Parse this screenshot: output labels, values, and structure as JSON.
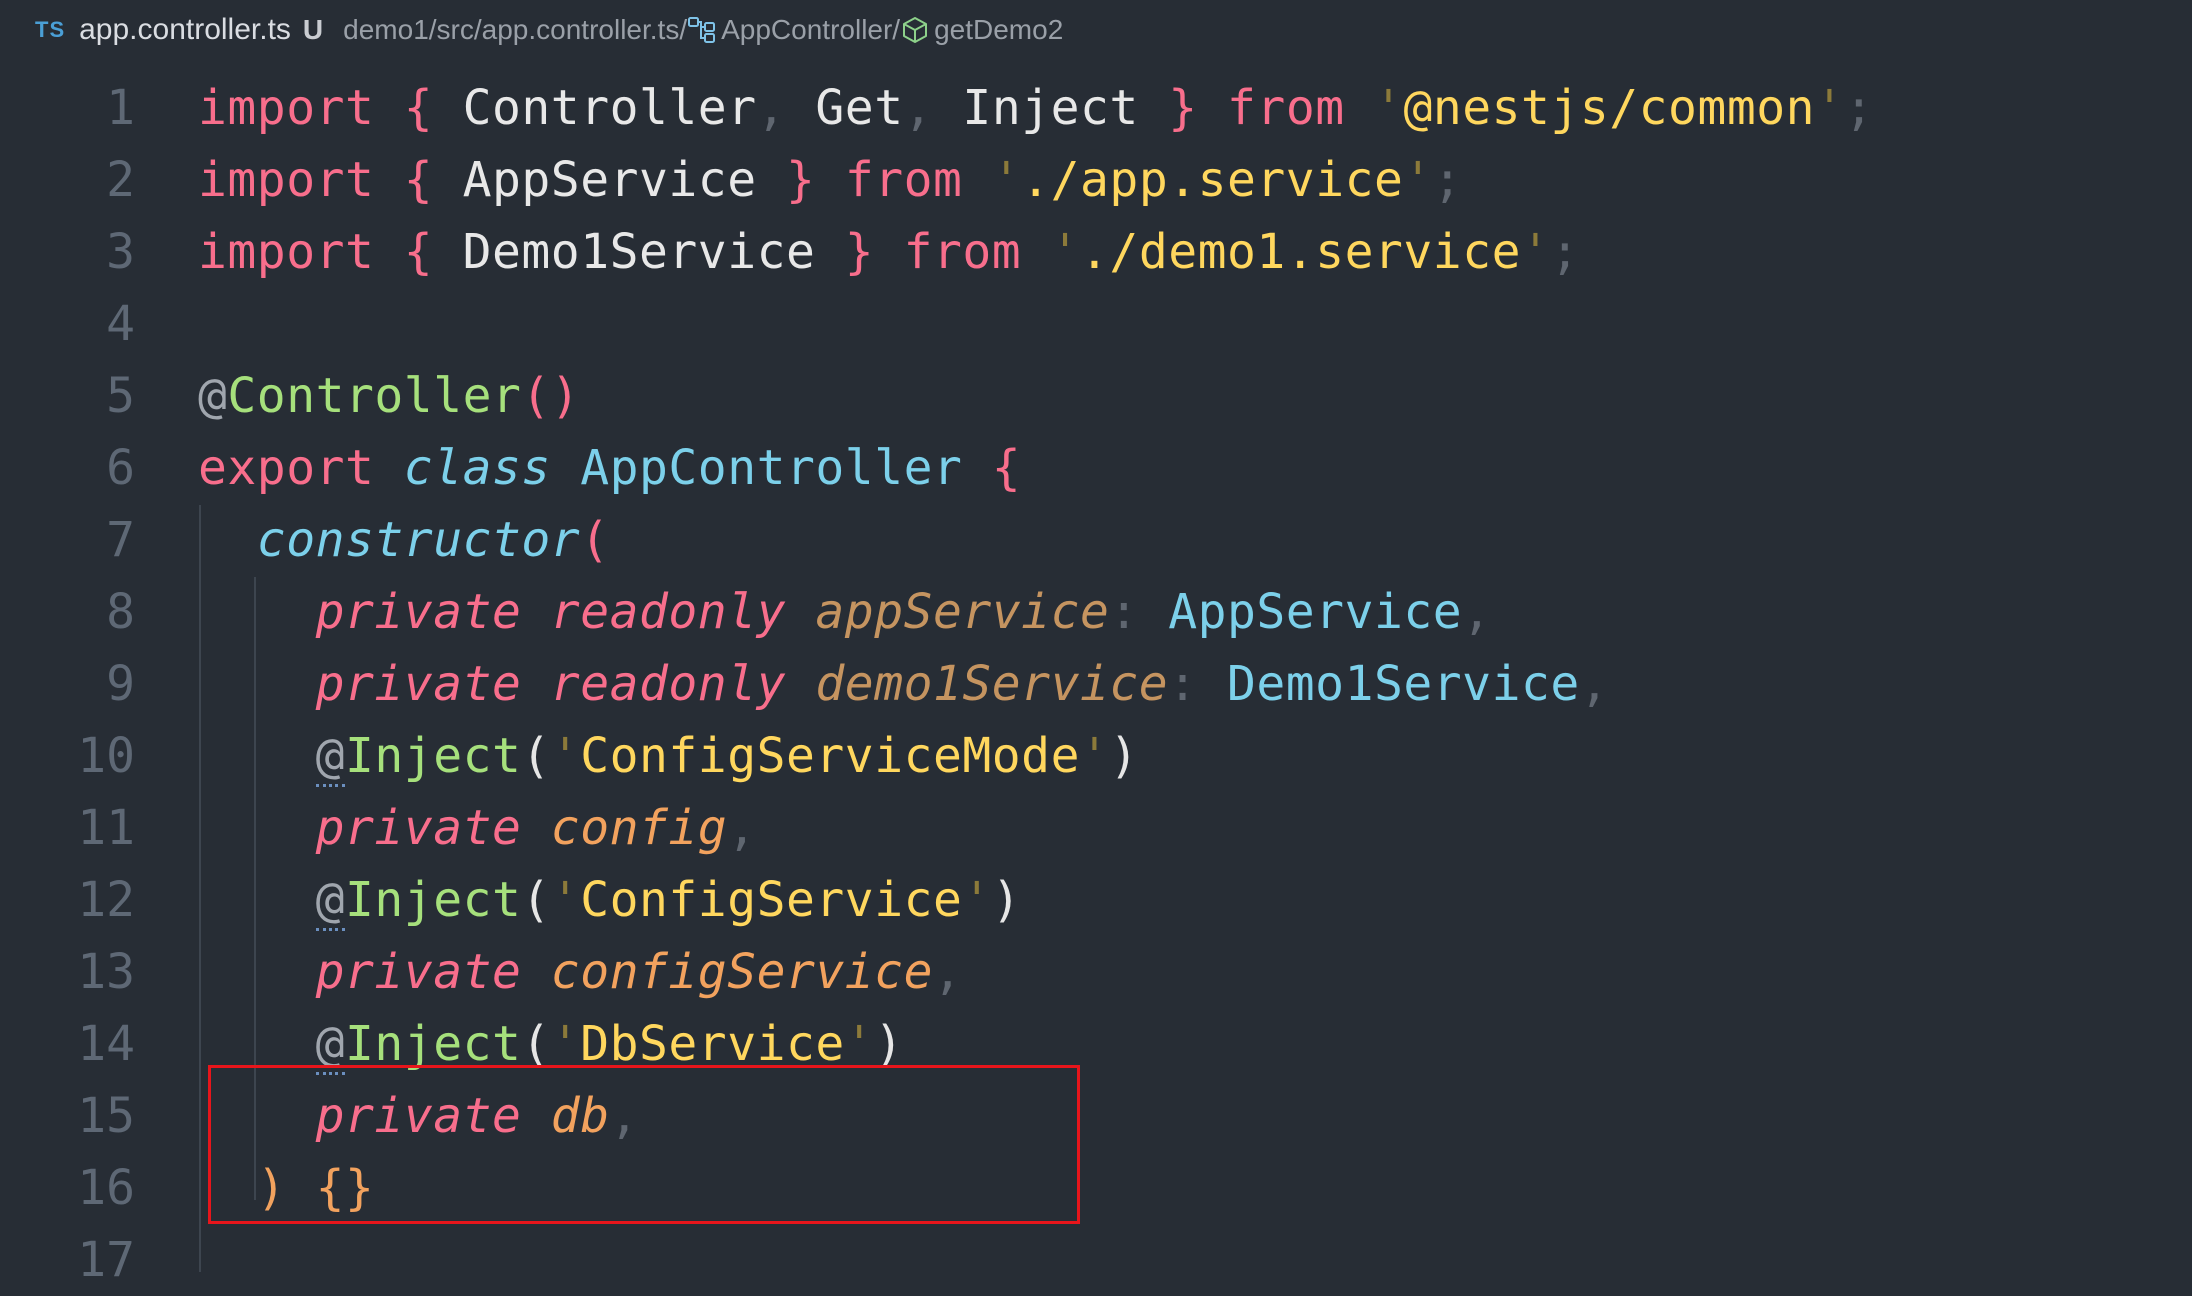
{
  "tab": {
    "lang_badge": "TS",
    "filename": "app.controller.ts",
    "status": "U"
  },
  "breadcrumb": {
    "path": "demo1/src/app.controller.ts/",
    "class_name": "AppController/",
    "method_name": "getDemo2"
  },
  "editor": {
    "line_numbers": [
      "1",
      "2",
      "3",
      "4",
      "5",
      "6",
      "7",
      "8",
      "9",
      "10",
      "11",
      "12",
      "13",
      "14",
      "15",
      "16",
      "17"
    ],
    "tokens": {
      "import": "import",
      "from": "from",
      "lbrace": "{",
      "rbrace": "}",
      "comma": ",",
      "semi": ";",
      "quote": "'",
      "controller": "Controller",
      "get": "Get",
      "inject": "Inject",
      "nestjs_common": "@nestjs/common",
      "app_service": "AppService",
      "app_service_path": "./app.service",
      "demo1_service": "Demo1Service",
      "demo1_service_path": "./demo1.service",
      "at": "@",
      "controller_call": "Controller",
      "parens": "()",
      "export": "export",
      "class": "class",
      "app_controller": "AppController",
      "constructor": "constructor",
      "lparen": "(",
      "rparen": ")",
      "private": "private",
      "readonly": "readonly",
      "app_service_param": "appService",
      "demo1_service_param": "demo1Service",
      "colon": ":",
      "config_service_mode": "ConfigServiceMode",
      "config": "config",
      "config_service_str": "ConfigService",
      "config_service_param": "configService",
      "db_service_str": "DbService",
      "db": "db",
      "empty_body": "{}"
    }
  },
  "colors": {
    "background": "#272d35",
    "keyword": "#f86e8c",
    "string": "#ffd75e",
    "decorator": "#a6e07c",
    "type": "#7cd0ea",
    "parameter": "#f2a25e",
    "line_number": "#5e6875",
    "highlight_box": "#e8151b"
  },
  "annotation": {
    "highlight_lines": "14-15"
  }
}
